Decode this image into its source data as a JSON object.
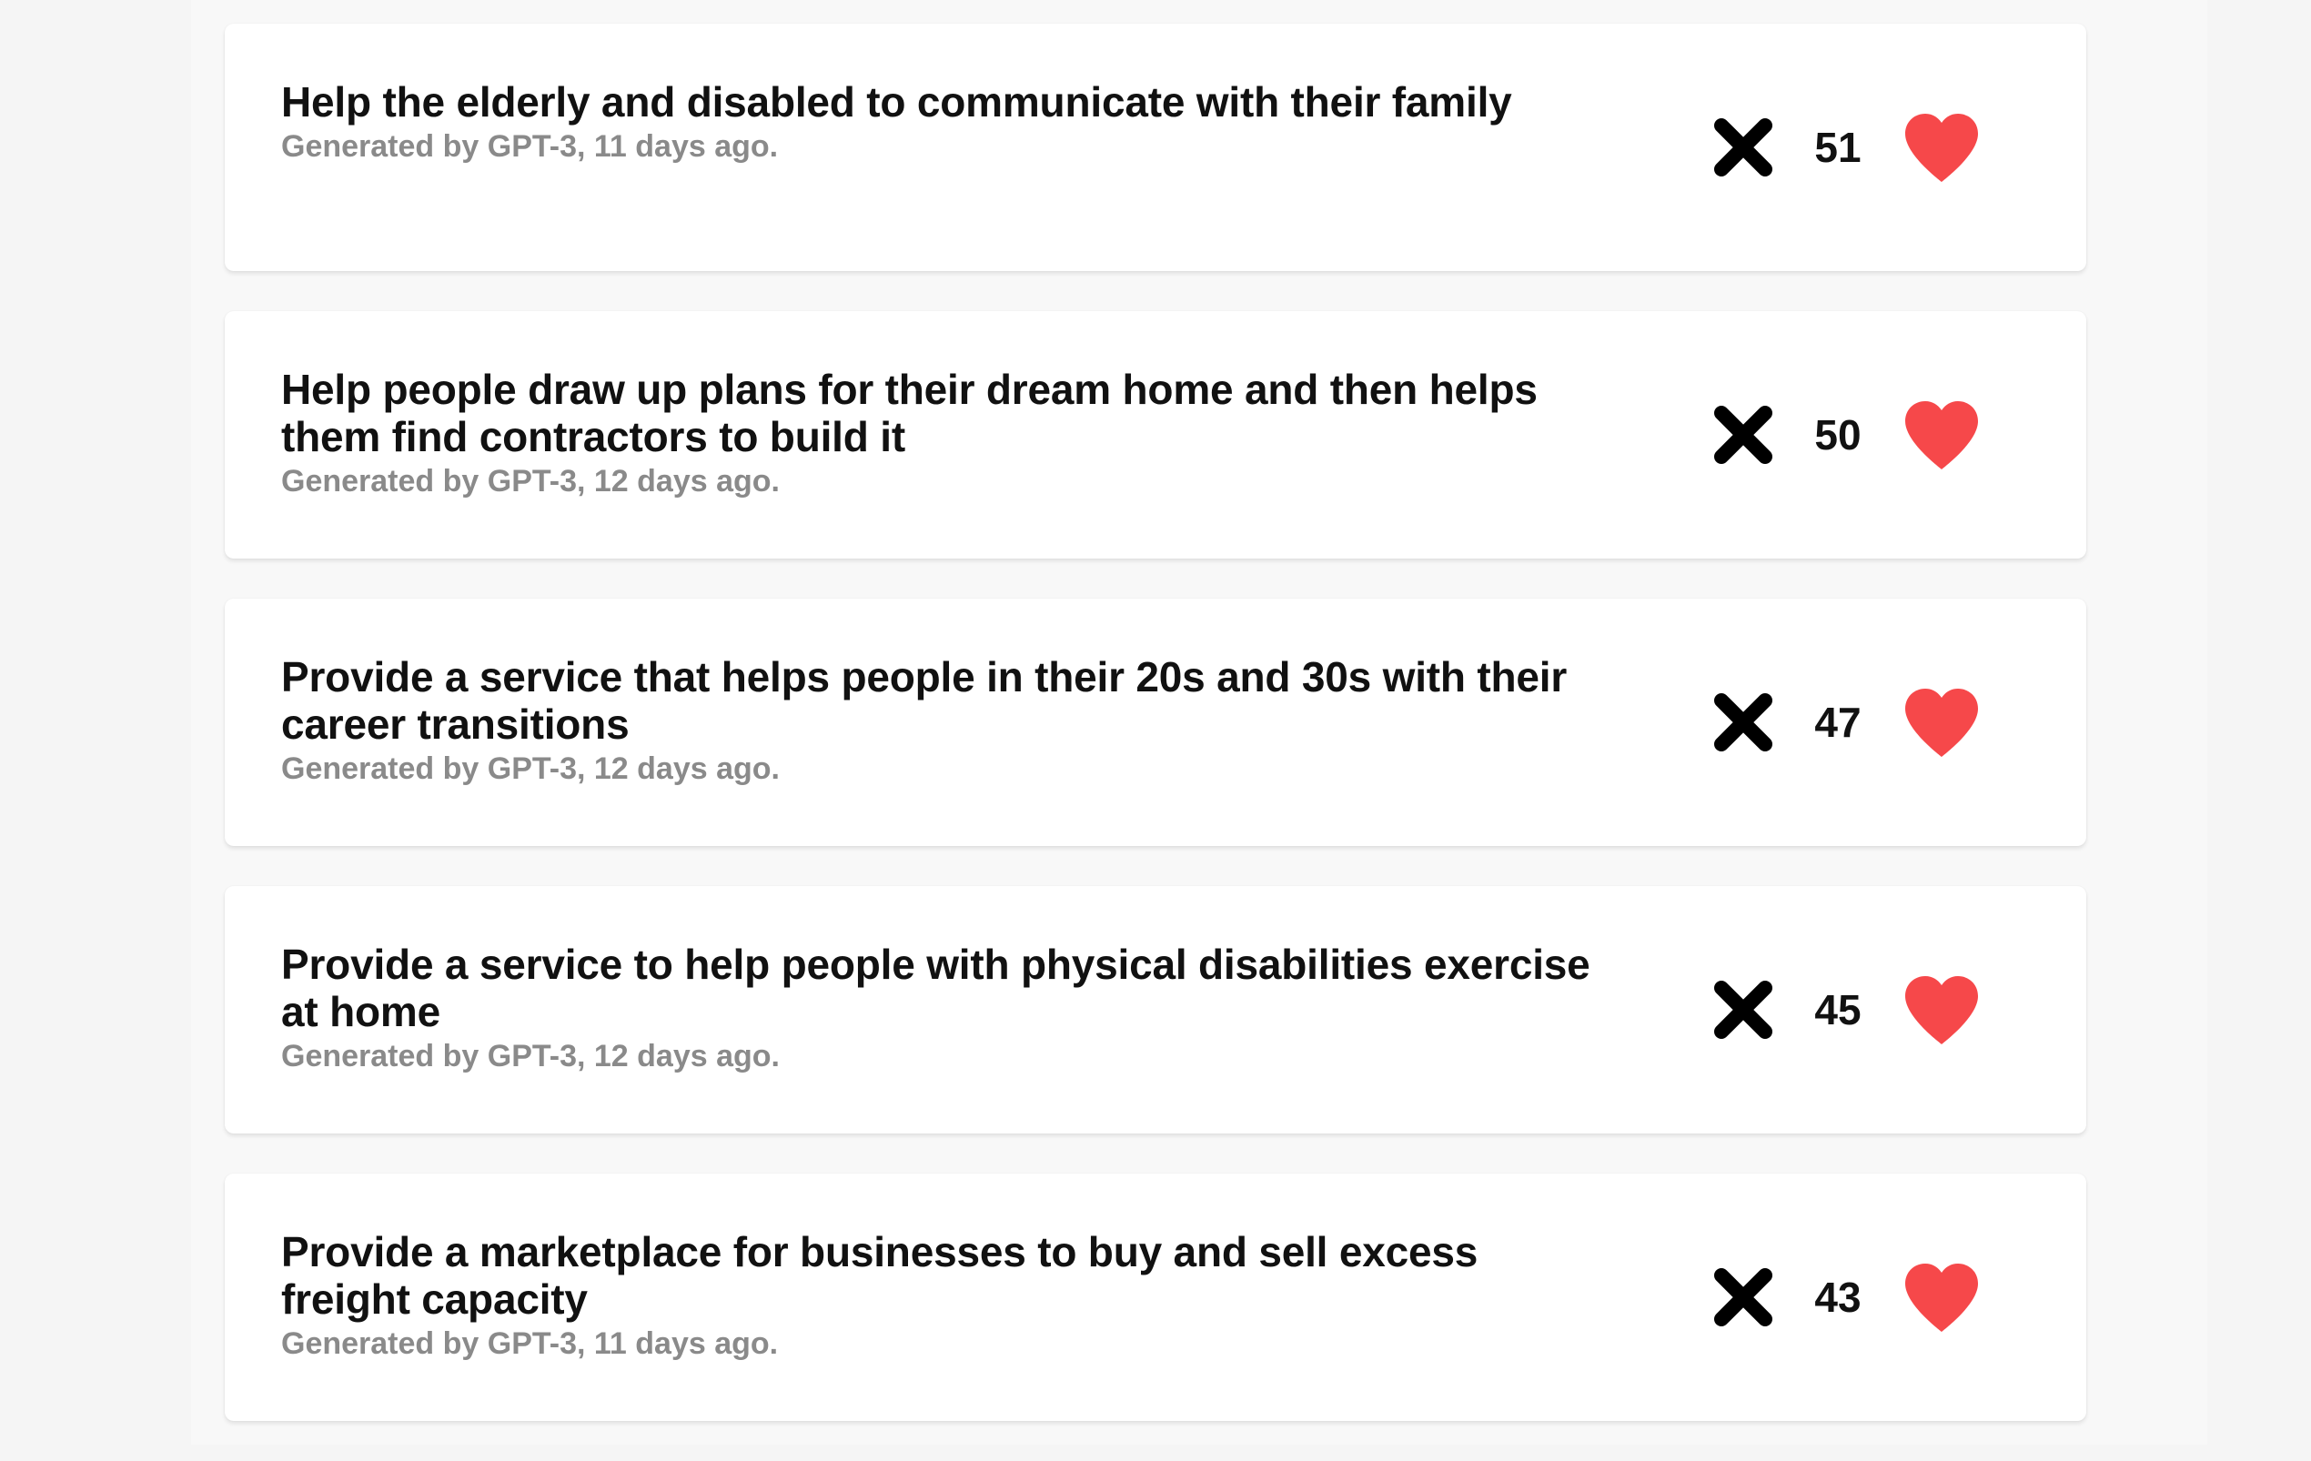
{
  "ideas": [
    {
      "title": "Help the elderly and disabled to communicate with their family",
      "meta": "Generated by GPT-3, 11 days ago.",
      "votes": "51"
    },
    {
      "title": "Help people draw up plans for their dream home and then helps them find contractors to build it",
      "meta": "Generated by GPT-3, 12 days ago.",
      "votes": "50"
    },
    {
      "title": "Provide a service that helps people in their 20s and 30s with their career transitions",
      "meta": "Generated by GPT-3, 12 days ago.",
      "votes": "47"
    },
    {
      "title": "Provide a service to help people with physical disabilities exercise at home",
      "meta": "Generated by GPT-3, 12 days ago.",
      "votes": "45"
    },
    {
      "title": "Provide a marketplace for businesses to buy and sell excess freight capacity",
      "meta": "Generated by GPT-3, 11 days ago.",
      "votes": "43"
    }
  ],
  "icons": {
    "reject": "close-icon",
    "like": "heart-icon"
  },
  "colors": {
    "heart": "#f6484a",
    "text": "#111111",
    "meta": "#8a8a8a",
    "card": "#ffffff",
    "background": "#f8f8f8"
  }
}
